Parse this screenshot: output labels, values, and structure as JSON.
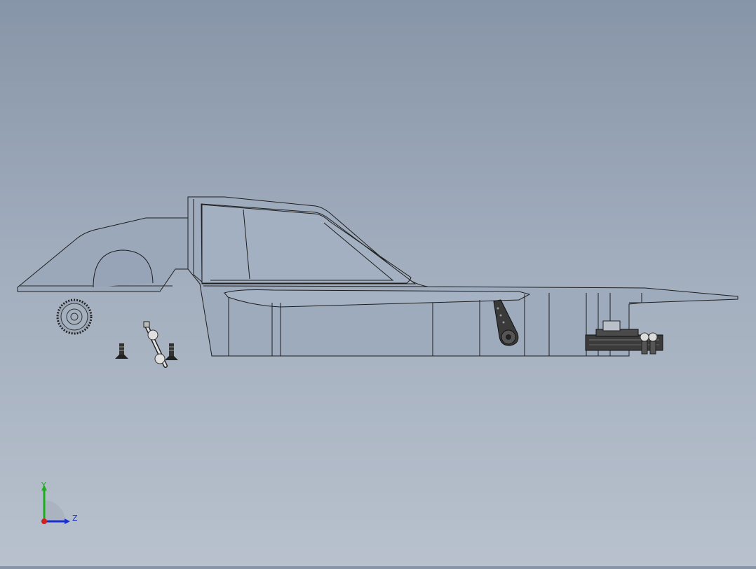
{
  "viewport": {
    "background_top": "#8795a8",
    "background_bottom": "#b8c1cd",
    "model_edge_color": "#1e1e1e",
    "body_fill": "#9aa7b9",
    "dark_part_color": "#3a3a3a"
  },
  "triad": {
    "y_label": "Y",
    "z_label": "Z",
    "y_color": "#19b019",
    "z_color": "#1b2fd0",
    "x_color": "#d02020"
  },
  "parts": [
    {
      "name": "car-body-shell"
    },
    {
      "name": "spur-gear"
    },
    {
      "name": "screw"
    },
    {
      "name": "drive-shaft"
    },
    {
      "name": "servo-horn"
    },
    {
      "name": "servo-mount-bracket"
    },
    {
      "name": "ball-link"
    }
  ]
}
